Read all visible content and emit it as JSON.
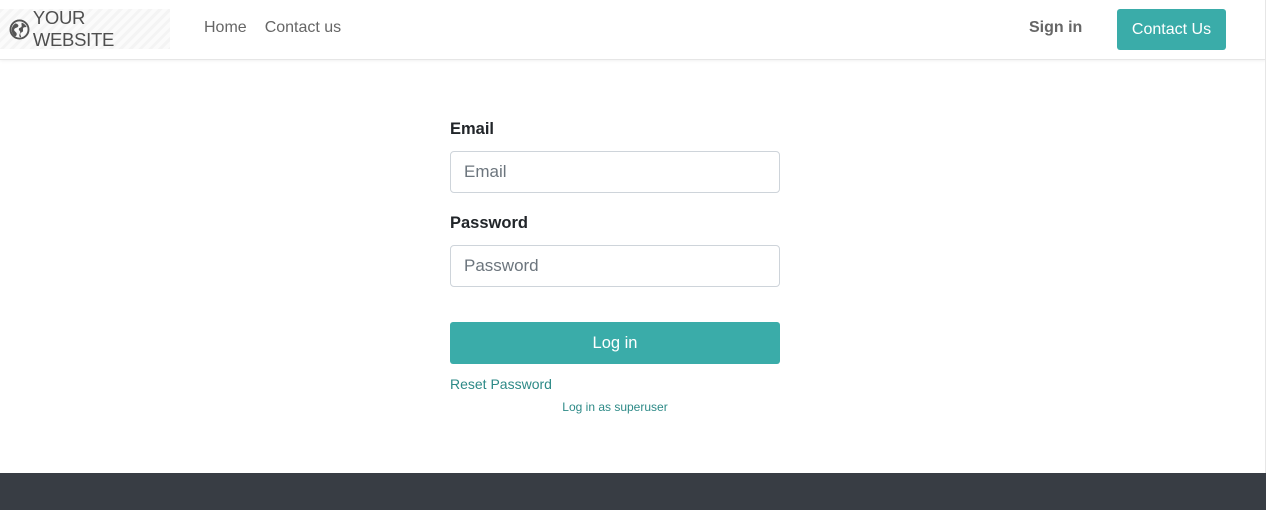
{
  "header": {
    "brand": {
      "icon": "globe-icon",
      "text": "YOUR WEBSITE"
    },
    "nav": [
      {
        "label": "Home"
      },
      {
        "label": "Contact us"
      }
    ],
    "sign_in": "Sign in",
    "contact_button": "Contact Us"
  },
  "login_form": {
    "email": {
      "label": "Email",
      "placeholder": "Email",
      "value": ""
    },
    "password": {
      "label": "Password",
      "placeholder": "Password",
      "value": ""
    },
    "submit_label": "Log in",
    "reset_password": "Reset Password",
    "superuser_link": "Log in as superuser"
  },
  "colors": {
    "accent": "#3aaca9",
    "link": "#2d8a87",
    "footer": "#383d44",
    "nav_text": "#666666"
  }
}
